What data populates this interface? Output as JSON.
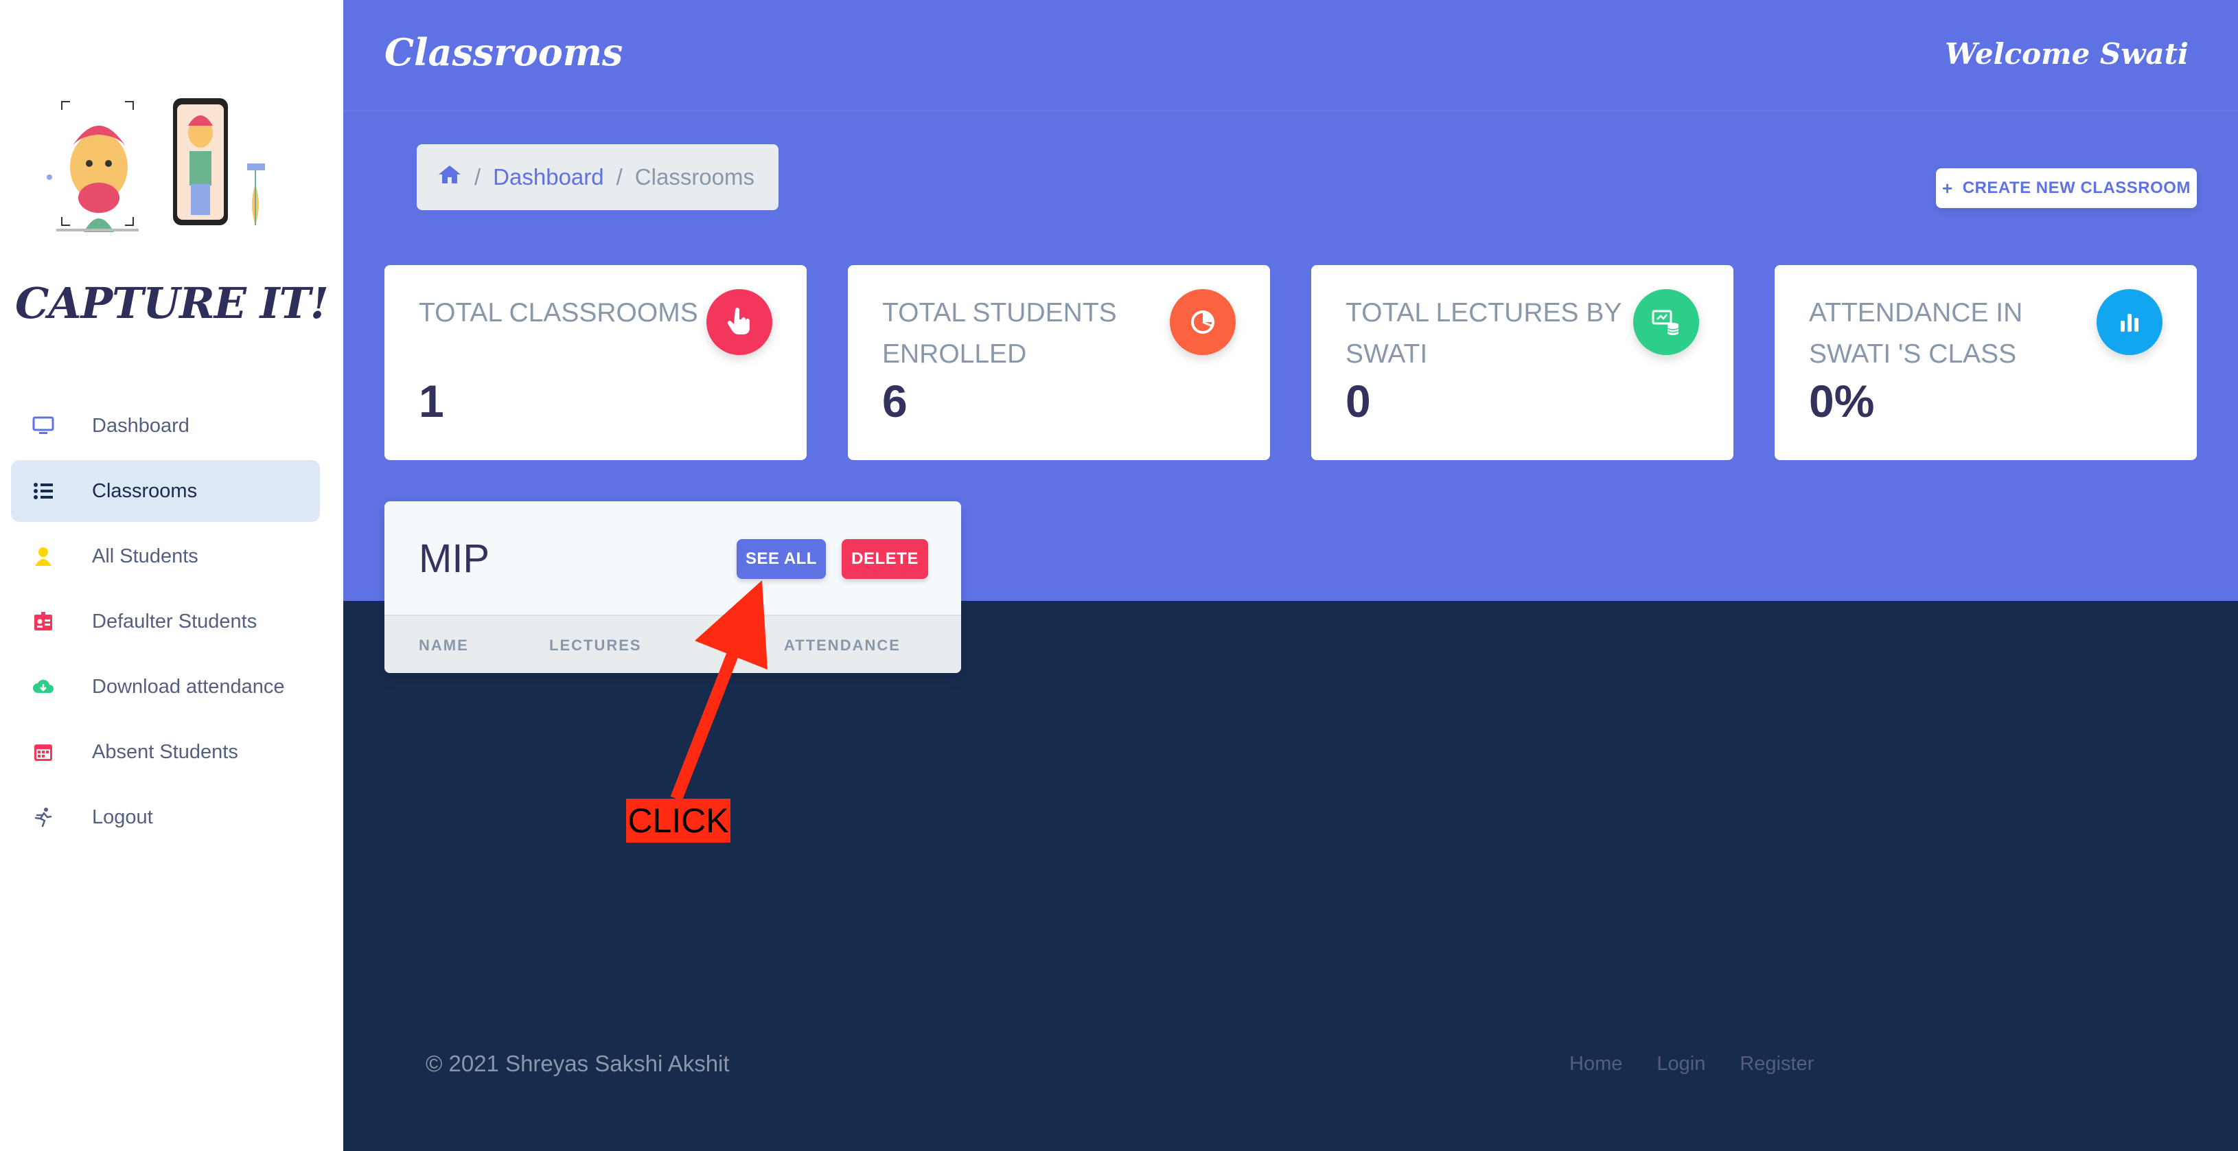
{
  "app": {
    "brand": "CAPTURE IT!"
  },
  "header": {
    "title": "Classrooms",
    "welcome": "Welcome Swati",
    "accent": "#5e72e4"
  },
  "sidebar": {
    "items": [
      {
        "label": "Dashboard",
        "icon": "monitor-icon",
        "active": false
      },
      {
        "label": "Classrooms",
        "icon": "list-icon",
        "active": true
      },
      {
        "label": "All Students",
        "icon": "user-icon",
        "active": false
      },
      {
        "label": "Defaulter Students",
        "icon": "id-badge-icon",
        "active": false
      },
      {
        "label": "Download attendance",
        "icon": "cloud-download-icon",
        "active": false
      },
      {
        "label": "Absent Students",
        "icon": "calendar-icon",
        "active": false
      },
      {
        "label": "Logout",
        "icon": "running-person-icon",
        "active": false
      }
    ]
  },
  "breadcrumb": {
    "home_icon": "home-icon",
    "dashboard": "Dashboard",
    "current": "Classrooms",
    "separator": "/"
  },
  "actions": {
    "create_new": "CREATE NEW CLASSROOM"
  },
  "stats": [
    {
      "title": "TOTAL CLASSROOMS",
      "value": "1",
      "icon": "hand-pointer-icon",
      "color": "#f5365c"
    },
    {
      "title": "TOTAL STUDENTS ENROLLED",
      "value": "6",
      "icon": "pie-chart-icon",
      "color": "#fb6340"
    },
    {
      "title": "TOTAL LECTURES BY SWATI",
      "value": "0",
      "icon": "presentation-database-icon",
      "color": "#2dce89"
    },
    {
      "title": "ATTENDANCE IN SWATI 'S CLASS",
      "value": "0%",
      "icon": "bar-chart-icon",
      "color": "#11cdef"
    }
  ],
  "classroom": {
    "name": "MIP",
    "see_all": "SEE ALL",
    "delete": "DELETE",
    "columns": [
      "NAME",
      "LECTURES",
      "ATTENDANCE"
    ]
  },
  "annotation": {
    "label": "CLICK"
  },
  "footer": {
    "copyright": "© 2021 Shreyas Sakshi Akshit",
    "links": [
      "Home",
      "Login",
      "Register"
    ]
  }
}
